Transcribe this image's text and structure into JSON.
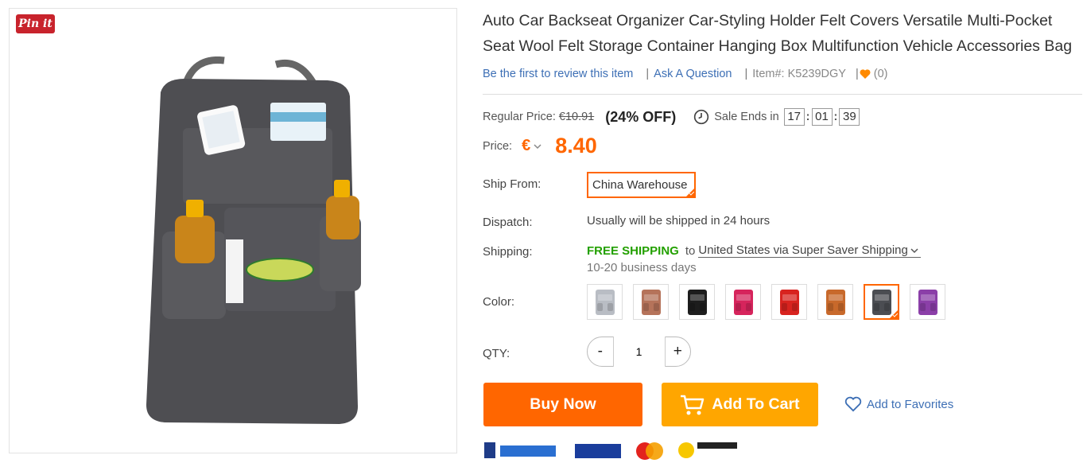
{
  "image_panel": {
    "pinit_label": "Pin it"
  },
  "product": {
    "title": "Auto Car Backseat Organizer Car-Styling Holder Felt Covers Versatile Multi-Pocket Seat Wool Felt Storage Container Hanging Box Multifunction Vehicle Accessories Bag",
    "review_link": "Be the first to review this item",
    "ask_link": "Ask A Question",
    "item_number": "Item#: K5239DGY",
    "favorite_count": "(0)"
  },
  "pricing": {
    "regular_label": "Regular Price:",
    "regular_price": "€10.91",
    "discount": "(24% OFF)",
    "sale_label": "Sale Ends in",
    "timer": {
      "hours": "17",
      "minutes": "01",
      "seconds": "39"
    },
    "price_label": "Price:",
    "currency": "€",
    "price": "8.40"
  },
  "shipping": {
    "ship_from_label": "Ship From:",
    "warehouse": "China Warehouse",
    "dispatch_label": "Dispatch:",
    "dispatch_text": "Usually will be shipped in 24 hours",
    "shipping_label": "Shipping:",
    "free_shipping": "FREE SHIPPING",
    "to": "to",
    "destination": "United States via Super Saver Shipping",
    "days": "10-20 business days"
  },
  "color": {
    "label": "Color:",
    "options": [
      {
        "name": "light-gray",
        "hex": "#b9bdc4"
      },
      {
        "name": "brown",
        "hex": "#b5735a"
      },
      {
        "name": "black",
        "hex": "#1d1d1d"
      },
      {
        "name": "rose-red",
        "hex": "#d6245c"
      },
      {
        "name": "red",
        "hex": "#d8231f"
      },
      {
        "name": "tan",
        "hex": "#c8692b"
      },
      {
        "name": "dark-gray",
        "hex": "#4b4d52",
        "selected": true
      },
      {
        "name": "purple",
        "hex": "#8b3fa8"
      }
    ]
  },
  "quantity": {
    "label": "QTY:",
    "value": "1",
    "minus": "-",
    "plus": "+"
  },
  "actions": {
    "buy_now": "Buy Now",
    "add_to_cart": "Add To Cart",
    "add_to_favorites": "Add to Favorites"
  },
  "colors": {
    "accent": "#ff6600",
    "cart": "#ffa600",
    "link": "#3d6fb5",
    "free": "#23a000"
  }
}
